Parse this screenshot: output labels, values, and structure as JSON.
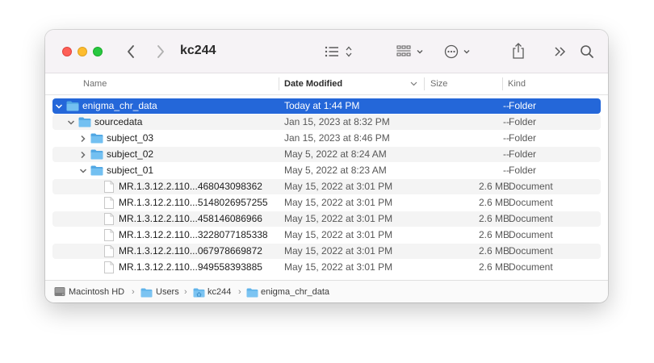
{
  "window": {
    "title": "kc244"
  },
  "toolbar": {
    "back_icon": "chevron-left-icon",
    "forward_icon": "chevron-right-icon",
    "view_icon": "list-view-icon",
    "group_icon": "grid-group-icon",
    "action_icon": "ellipsis-circle-icon",
    "share_icon": "share-icon",
    "more_icon": "double-chevron-icon",
    "search_icon": "search-icon"
  },
  "columns": {
    "name": "Name",
    "date": "Date Modified",
    "size": "Size",
    "kind": "Kind"
  },
  "rows": [
    {
      "name": "enigma_chr_data",
      "date": "Today at 1:44 PM",
      "size": "--",
      "kind": "Folder",
      "type": "folder",
      "disclosure": "expanded",
      "level": 0,
      "selected": true
    },
    {
      "name": "sourcedata",
      "date": "Jan 15, 2023 at 8:32 PM",
      "size": "--",
      "kind": "Folder",
      "type": "folder",
      "disclosure": "expanded",
      "level": 1
    },
    {
      "name": "subject_03",
      "date": "Jan 15, 2023 at 8:46 PM",
      "size": "--",
      "kind": "Folder",
      "type": "folder",
      "disclosure": "collapsed",
      "level": 2
    },
    {
      "name": "subject_02",
      "date": "May 5, 2022 at 8:24 AM",
      "size": "--",
      "kind": "Folder",
      "type": "folder",
      "disclosure": "collapsed",
      "level": 2
    },
    {
      "name": "subject_01",
      "date": "May 5, 2022 at 8:23 AM",
      "size": "--",
      "kind": "Folder",
      "type": "folder",
      "disclosure": "expanded",
      "level": 2
    },
    {
      "name": "MR.1.3.12.2.110...468043098362",
      "date": "May 15, 2022 at 3:01 PM",
      "size": "2.6 MB",
      "kind": "Document",
      "type": "document",
      "level": 3
    },
    {
      "name": "MR.1.3.12.2.110...5148026957255",
      "date": "May 15, 2022 at 3:01 PM",
      "size": "2.6 MB",
      "kind": "Document",
      "type": "document",
      "level": 3
    },
    {
      "name": "MR.1.3.12.2.110...458146086966",
      "date": "May 15, 2022 at 3:01 PM",
      "size": "2.6 MB",
      "kind": "Document",
      "type": "document",
      "level": 3
    },
    {
      "name": "MR.1.3.12.2.110...3228077185338",
      "date": "May 15, 2022 at 3:01 PM",
      "size": "2.6 MB",
      "kind": "Document",
      "type": "document",
      "level": 3
    },
    {
      "name": "MR.1.3.12.2.110...067978669872",
      "date": "May 15, 2022 at 3:01 PM",
      "size": "2.6 MB",
      "kind": "Document",
      "type": "document",
      "level": 3
    },
    {
      "name": "MR.1.3.12.2.110...949558393885",
      "date": "May 15, 2022 at 3:01 PM",
      "size": "2.6 MB",
      "kind": "Document",
      "type": "document",
      "level": 3
    }
  ],
  "pathbar": [
    {
      "label": "Macintosh HD",
      "icon": "hard-drive-icon"
    },
    {
      "label": "Users",
      "icon": "folder-icon"
    },
    {
      "label": "kc244",
      "icon": "home-folder-icon"
    },
    {
      "label": "enigma_chr_data",
      "icon": "folder-icon"
    }
  ],
  "colors": {
    "selection": "#2467d9",
    "folder": "#5fb3ea",
    "close": "#fe5f57",
    "minimize": "#febc2e",
    "zoom": "#28c840"
  }
}
